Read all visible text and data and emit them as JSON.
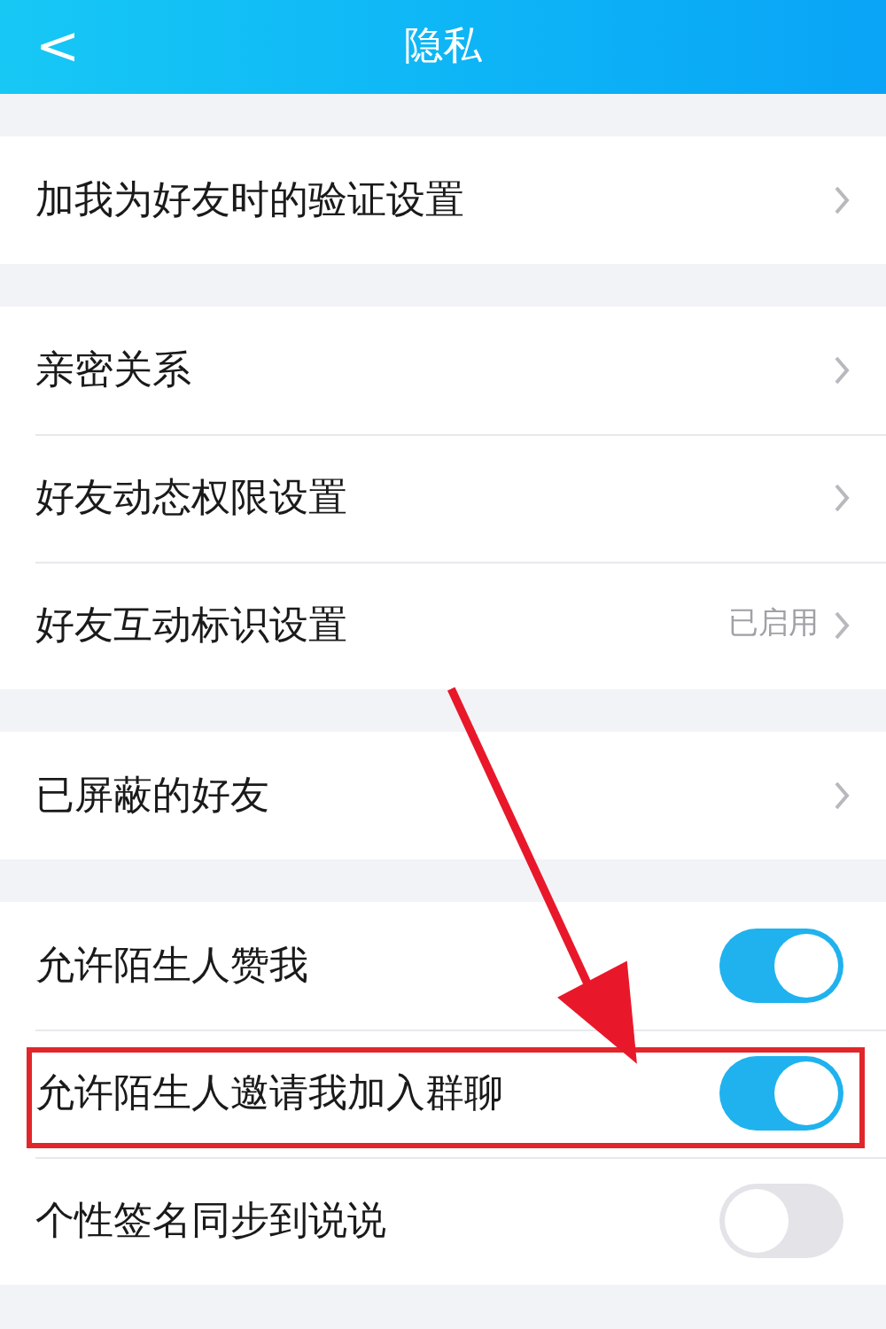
{
  "header": {
    "back": "<",
    "title": "隐私"
  },
  "sections": [
    {
      "items": [
        {
          "kind": "link",
          "label": "加我为好友时的验证设置"
        }
      ]
    },
    {
      "items": [
        {
          "kind": "link",
          "label": "亲密关系"
        },
        {
          "kind": "link",
          "label": "好友动态权限设置"
        },
        {
          "kind": "link",
          "label": "好友互动标识设置",
          "value": "已启用"
        }
      ]
    },
    {
      "items": [
        {
          "kind": "link",
          "label": "已屏蔽的好友"
        }
      ]
    },
    {
      "items": [
        {
          "kind": "toggle",
          "label": "允许陌生人赞我",
          "on": true
        },
        {
          "kind": "toggle",
          "label": "允许陌生人邀请我加入群聊",
          "on": true,
          "highlighted": true
        },
        {
          "kind": "toggle",
          "label": "个性签名同步到说说",
          "on": false
        }
      ]
    }
  ]
}
